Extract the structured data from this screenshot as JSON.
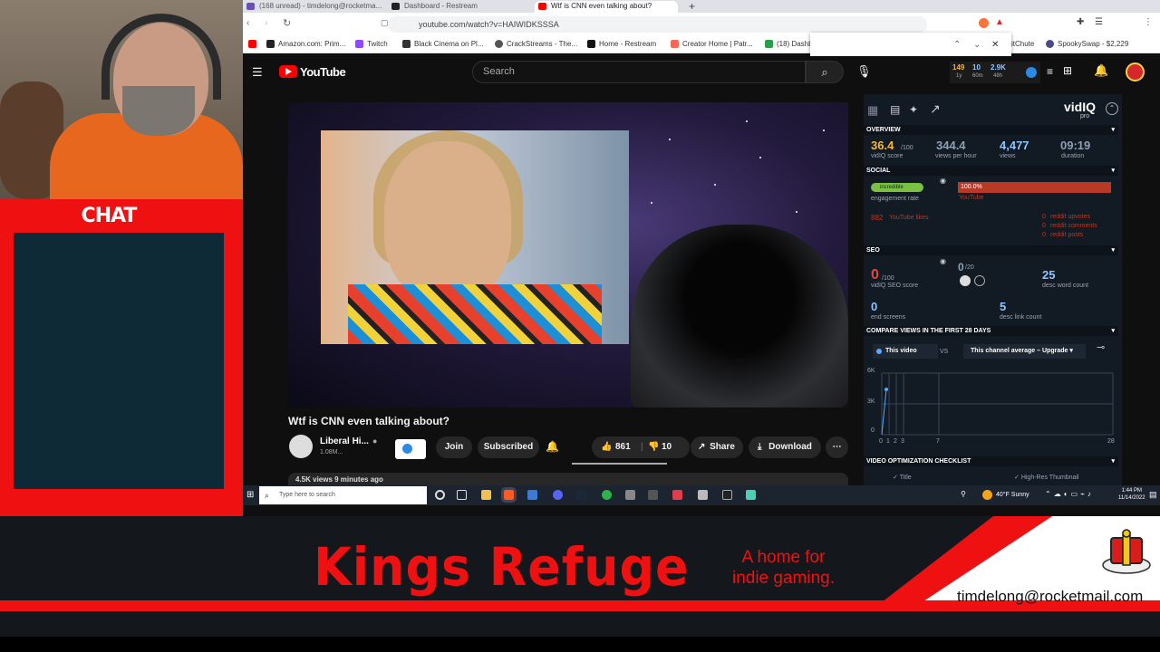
{
  "chat_panel": {
    "title": "CHAT"
  },
  "browser": {
    "tabs": [
      {
        "label": "(168 unread) - timdelong@rocketma...",
        "color": "#6b4fbb"
      },
      {
        "label": "Dashboard - Restream",
        "color": "#222222"
      },
      {
        "label": "Wtf is CNN even talking about?",
        "color": "#ff0000"
      }
    ],
    "new_tab": "+",
    "url": "youtube.com/watch?v=HAIWIDKSSSA",
    "bookmarks": [
      "Amazon.com: Prim...",
      "Twitch",
      "Black Cinema on Pl...",
      "CrackStreams - The...",
      "Home - Restream",
      "Creator Home | Patr...",
      "(18) Dashb",
      "itChute",
      "SpookySwap - $2,229"
    ]
  },
  "youtube": {
    "logo": "YouTube",
    "search_placeholder": "Search",
    "vidiq_stats": {
      "a": "149",
      "b": "10",
      "c": "2.9K",
      "a_sub": "1y",
      "b_sub": "60m",
      "c_sub": "48h"
    },
    "video_title": "Wtf is CNN even talking about?",
    "channel_name": "Liberal Hi...",
    "subscribers": "1.08M...",
    "join": "Join",
    "subscribed": "Subscribed",
    "likes": "861",
    "dislikes": "10",
    "share": "Share",
    "download": "Download",
    "description_peek": "4.5K views  9 minutes ago"
  },
  "vidiq": {
    "brand": "vidIQ",
    "brand_sub": "pro",
    "overview": {
      "heading": "OVERVIEW",
      "score": "36.4",
      "score_max": "/100",
      "score_label": "vidIQ score",
      "vph": "344.4",
      "vph_label": "views per hour",
      "views": "4,477",
      "views_label": "views",
      "duration": "09:19",
      "duration_label": "duration"
    },
    "social": {
      "heading": "SOCIAL",
      "engagement_badge": "incredible",
      "engagement_label": "engagement rate",
      "youtube_pct": "100.0%",
      "youtube_label": "YouTube",
      "likes_count": "882",
      "likes_label": "YouTube likes",
      "reddit": [
        {
          "value": "0",
          "label": "reddit upvotes"
        },
        {
          "value": "0",
          "label": "reddit comments"
        },
        {
          "value": "0",
          "label": "reddit posts"
        }
      ]
    },
    "seo": {
      "heading": "SEO",
      "score": "0",
      "score_max": "/100",
      "score_label": "vidIQ SEO score",
      "tags": "0",
      "tags_max": "/20",
      "desc_words": "25",
      "desc_words_label": "desc word count",
      "end_screens": "0",
      "end_screens_label": "end screens",
      "desc_links": "5",
      "desc_links_label": "desc link count"
    },
    "compare": {
      "heading": "COMPARE VIEWS IN THE FIRST 28 DAYS",
      "this_video": "This video",
      "vs": "VS",
      "channel_avg": "This channel average",
      "upgrade": "Upgrade",
      "y_ticks": [
        "6K",
        "3K",
        "0"
      ],
      "x_ticks": [
        "0",
        "1",
        "2",
        "3",
        "7",
        "28"
      ]
    },
    "checklist": {
      "heading": "VIDEO OPTIMIZATION CHECKLIST",
      "items": [
        "Title",
        "High-Res Thumbnail"
      ]
    }
  },
  "taskbar": {
    "search_placeholder": "Type here to search",
    "weather": "40°F  Sunny",
    "time": "1:44 PM",
    "date": "11/14/2022"
  },
  "banner": {
    "brand": "Kings Refuge",
    "tagline_1": "A home for",
    "tagline_2": "indie gaming.",
    "email": "timdelong@rocketmail.com"
  },
  "colors": {
    "accent_red": "#ef1111",
    "chat_bg": "#0e2a36",
    "yt_red": "#ff0000",
    "vidiq_bg": "#121a24"
  }
}
